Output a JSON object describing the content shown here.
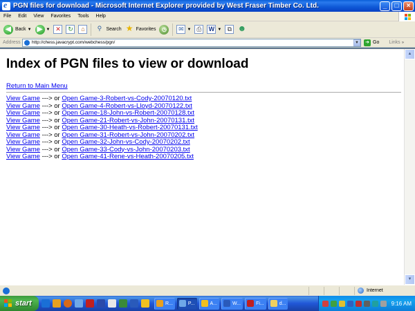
{
  "window": {
    "title": "PGN files for download - Microsoft Internet Explorer provided by West Fraser Timber Co. Ltd."
  },
  "menu": [
    "File",
    "Edit",
    "View",
    "Favorites",
    "Tools",
    "Help"
  ],
  "toolbar": {
    "back_label": "Back",
    "search_label": "Search",
    "favorites_label": "Favorites"
  },
  "address": {
    "label": "Address",
    "url": "http://chess.javacrypt.com/webchess/pgn/",
    "go_label": "Go",
    "links_label": "Links"
  },
  "page": {
    "heading": "Index of PGN files to view or download",
    "return_link": "Return to Main Menu",
    "view_label": "View Game",
    "arrow_text": " ---> or ",
    "games": [
      "Open Game-3-Robert-vs-Cody-20070120.txt",
      "Open Game-4-Robert-vs-Lloyd-20070122.txt",
      "Open Game-18-John-vs-Robert-20070128.txt",
      "Open Game-21-Robert-vs-John-20070131.txt",
      "Open Game-30-Heath-vs-Robert-20070131.txt",
      "Open Game-31-Robert-vs-John-20070202.txt",
      "Open Game-32-John-vs-Cody-20070202.txt",
      "Open Game-33-Cody-vs-John-20070203.txt",
      "Open Game-41-Rene-vs-Heath-20070205.txt"
    ]
  },
  "status": {
    "zone": "Internet"
  },
  "taskbar": {
    "start_label": "start",
    "tasks": [
      "R...",
      "P...",
      "A...",
      "W...",
      "Fi...",
      "d..."
    ],
    "clock": "9:16 AM"
  },
  "colors": {
    "link": "#0000ee",
    "titlebar": "#0a5fd8",
    "taskbar": "#2157d7",
    "start": "#3c9a3c"
  }
}
